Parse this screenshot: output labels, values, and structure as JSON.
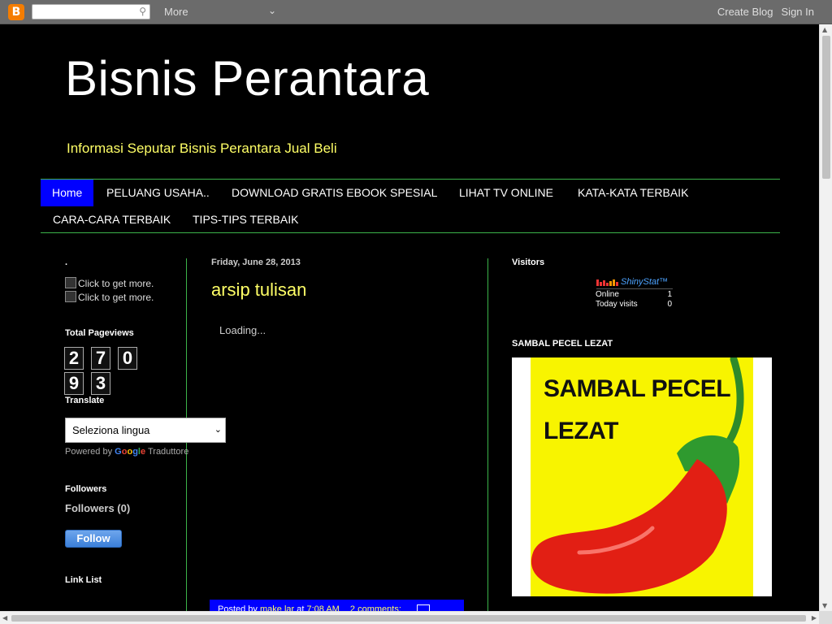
{
  "navbar": {
    "logo_glyph": "B",
    "more_label": "More",
    "create_blog": "Create Blog",
    "sign_in": "Sign In"
  },
  "header": {
    "title": "Bisnis Perantara",
    "description": "Informasi Seputar Bisnis Perantara Jual Beli"
  },
  "tabs": [
    {
      "label": "Home",
      "active": true
    },
    {
      "label": "PELUANG USAHA.."
    },
    {
      "label": "DOWNLOAD GRATIS EBOOK SPESIAL"
    },
    {
      "label": "LIHAT TV ONLINE"
    },
    {
      "label": "KATA-KATA TERBAIK"
    },
    {
      "label": "CARA-CARA TERBAIK"
    },
    {
      "label": "TIPS-TIPS TERBAIK"
    }
  ],
  "left_sidebar": {
    "dot_heading": ".",
    "click_more": [
      "Click to get more.",
      "Click to get more."
    ],
    "pageviews_heading": "Total Pageviews",
    "pageviews_digits": [
      "2",
      "7",
      "0",
      "9",
      "3"
    ],
    "translate_heading": "Translate",
    "language_select": "Seleziona lingua",
    "powered_by": "Powered by",
    "google_letters": [
      "G",
      "o",
      "o",
      "g",
      "l",
      "e"
    ],
    "translator": "Traduttore",
    "followers_heading": "Followers",
    "followers_count": "Followers (0)",
    "follow_button": "Follow",
    "link_list_heading": "Link List"
  },
  "main": {
    "date": "Friday, June 28, 2013",
    "post_title": "arsip tulisan",
    "loading": "Loading...",
    "footer_posted_by": "Posted by",
    "footer_author": "make lar",
    "footer_at": "at",
    "footer_time": "7:08 AM",
    "footer_comments": "2 comments:"
  },
  "right_sidebar": {
    "visitors_heading": "Visitors",
    "shinystat_logo": "ShinyStat™",
    "online_label": "Online",
    "online_value": "1",
    "today_label": "Today visits",
    "today_value": "0",
    "pecel_heading": "SAMBAL PECEL LEZAT",
    "pecel_line1": "SAMBAL PECEL",
    "pecel_line2": "LEZAT"
  },
  "colors": {
    "accent_tab": "#0000ff",
    "title_yellow": "#ffff66",
    "divider_green": "#3cb44a"
  }
}
